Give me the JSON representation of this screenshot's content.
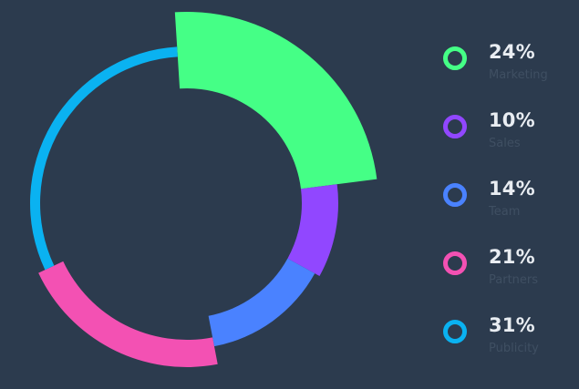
{
  "chart_data": {
    "type": "pie",
    "style": "donut-segmented",
    "categories": [
      "Marketing",
      "Sales",
      "Team",
      "Partners",
      "Publicity"
    ],
    "values": [
      24,
      10,
      14,
      21,
      31
    ],
    "colors": [
      "#45ff86",
      "#9147ff",
      "#4a82ff",
      "#f351b3",
      "#0ab2f1"
    ],
    "labels": [
      "24%",
      "10%",
      "14%",
      "21%",
      "31%"
    ],
    "background": "#2c3b4e"
  },
  "legend": {
    "items": [
      {
        "percent": "24%",
        "name": "Marketing",
        "color": "#45ff86"
      },
      {
        "percent": "10%",
        "name": "Sales",
        "color": "#9147ff"
      },
      {
        "percent": "14%",
        "name": "Team",
        "color": "#4a82ff"
      },
      {
        "percent": "21%",
        "name": "Partners",
        "color": "#f351b3"
      },
      {
        "percent": "31%",
        "name": "Publicity",
        "color": "#0ab2f1"
      }
    ]
  }
}
